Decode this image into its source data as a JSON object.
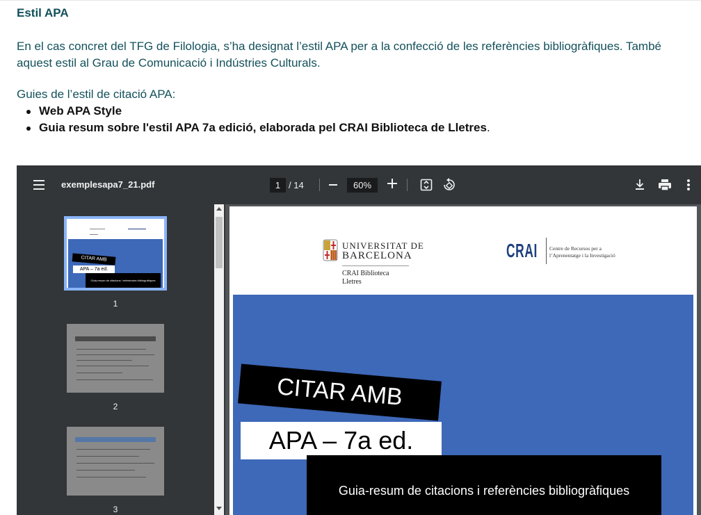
{
  "article": {
    "heading": "Estil APA",
    "paragraph_line1": "En el cas concret del TFG de Filologia, s’ha designat l’estil APA per a la confecció de les referències bibliogràfiques. També",
    "paragraph_line2": "aquest estil al Grau de Comunicació i Indústries Culturals.",
    "guides_intro": "Guies de l’estil de citació APA:",
    "bullets": [
      {
        "link": "Web APA Style",
        "suffix": ""
      },
      {
        "link": "Guia resum sobre l'estil APA 7a edició, elaborada pel CRAI Biblioteca de Lletres",
        "suffix": "."
      }
    ]
  },
  "viewer": {
    "filename": "exemplesapa7_21.pdf",
    "current_page": "1",
    "total_pages": "/ 14",
    "zoom": "60%",
    "icons": [
      "menu-icon",
      "zoom-out-icon",
      "zoom-in-icon",
      "fit-page-icon",
      "rotate-icon",
      "download-icon",
      "print-icon",
      "more-options-icon"
    ],
    "thumbnails": [
      {
        "number": "1",
        "selected": true
      },
      {
        "number": "2",
        "selected": false
      },
      {
        "number": "3",
        "selected": false
      }
    ],
    "accent_color": "#8ab4f8"
  },
  "document": {
    "ub_name_line1": "UNIVERSITAT DE",
    "ub_name_line2": "BARCELONA",
    "ub_library_line1": "CRAI Biblioteca",
    "ub_library_line2": "Lletres",
    "crai_logo": "CRAI",
    "crai_desc_line1": "Centre de Recursos per a",
    "crai_desc_line2": "l’Aprenentatge i la Investigació",
    "cover_title": "CITAR AMB",
    "cover_subtitle": "APA – 7a ed.",
    "cover_caption": "Guia-resum de citacions i referències bibliogràfiques",
    "cover_color": "#3e68b8",
    "thumb1_title": "CITAR AMB",
    "thumb1_subtitle": "APA – 7a ed.",
    "thumb1_caption": "Guia-resum de citacions i referències bibliogràfiques"
  }
}
